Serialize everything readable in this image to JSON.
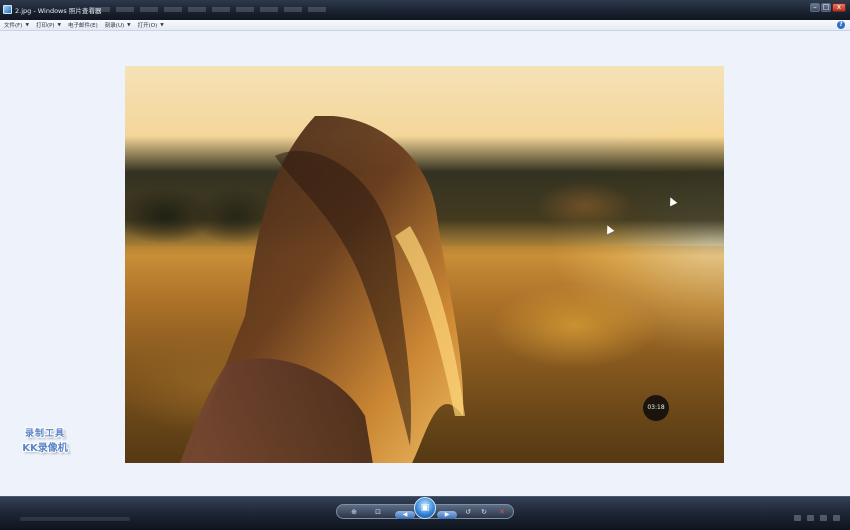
{
  "window": {
    "title": "2.jpg - Windows 照片查看器",
    "minimize_glyph": "–",
    "maximize_glyph": "□",
    "close_glyph": "x"
  },
  "menu": {
    "items": [
      {
        "label": "文件(F)",
        "has_dropdown": true
      },
      {
        "label": "打印(P)",
        "has_dropdown": true
      },
      {
        "label": "电子邮件(E)",
        "has_dropdown": false
      },
      {
        "label": "刻录(U)",
        "has_dropdown": true
      },
      {
        "label": "打开(O)",
        "has_dropdown": true
      }
    ],
    "help_glyph": "?"
  },
  "overlay": {
    "timer": "03:18"
  },
  "watermark": {
    "line1": "录制工具",
    "line2": "KK录像机"
  },
  "toolbar": {
    "zoom_icon": "magnifier-icon",
    "fit_icon": "fit-window-icon",
    "previous_icon": "previous-icon",
    "slideshow_icon": "slideshow-icon",
    "next_icon": "next-icon",
    "rotate_ccw_icon": "rotate-counterclockwise-icon",
    "rotate_cw_icon": "rotate-clockwise-icon",
    "delete_icon": "delete-icon",
    "prev_glyph": "◀",
    "next_glyph": "▶",
    "slideshow_glyph": "▣",
    "zoom_glyph": "⊕",
    "fit_glyph": "⊡",
    "rotate_ccw_glyph": "↺",
    "rotate_cw_glyph": "↻",
    "delete_glyph": "✕"
  },
  "colors": {
    "accent": "#2f7fd6",
    "delete": "#e0523f"
  }
}
